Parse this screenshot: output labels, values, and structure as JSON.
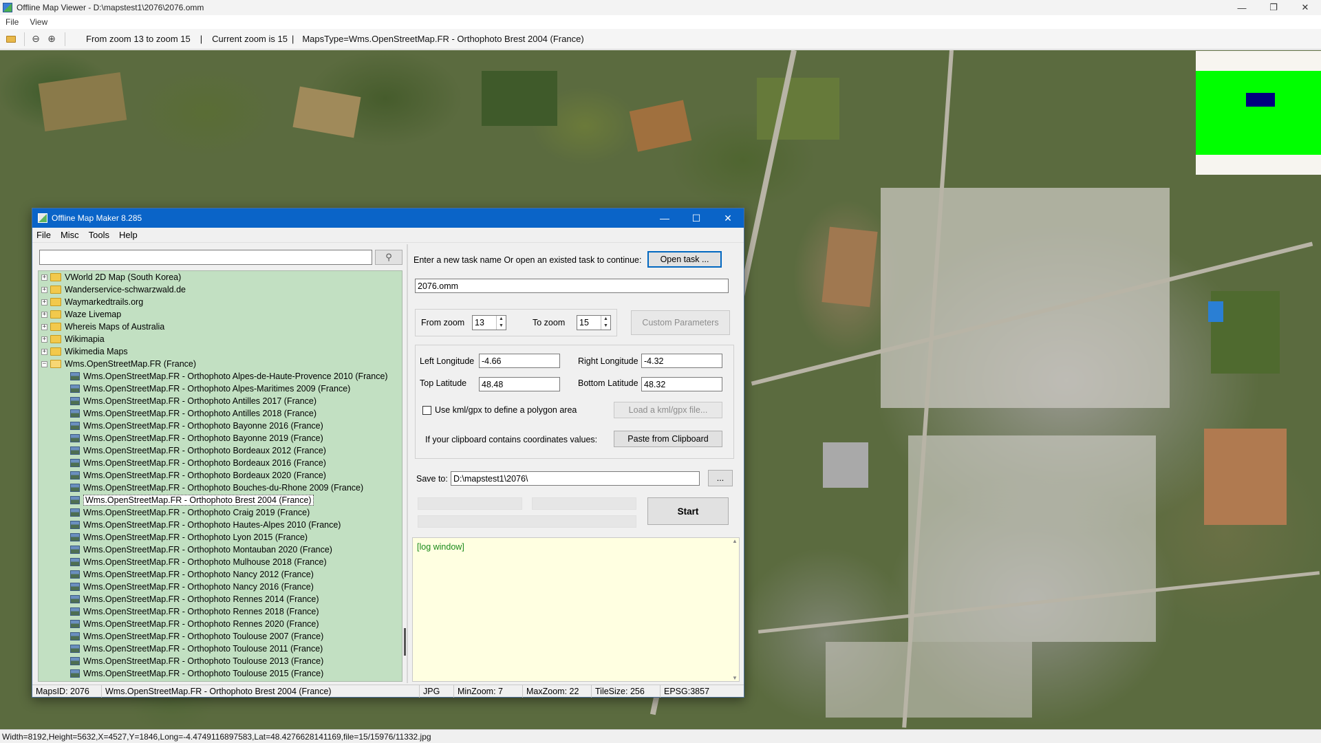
{
  "viewer": {
    "title": "Offline Map Viewer - D:\\mapstest1\\2076\\2076.omm",
    "menu": [
      "File",
      "View"
    ],
    "toolbar": {
      "zoom_range": "From zoom 13 to zoom 15",
      "current_zoom": "Current zoom is 15",
      "maps_type": "MapsType=Wms.OpenStreetMap.FR - Orthophoto Brest 2004 (France)",
      "separator": "|"
    },
    "status": "Width=8192,Height=5632,X=4527,Y=1846,Long=-4.4749116897583,Lat=48.4276628141169,file=15/15976/11332.jpg"
  },
  "dialog": {
    "title": "Offline Map Maker 8.285",
    "menu": [
      "File",
      "Misc",
      "Tools",
      "Help"
    ],
    "search": {
      "value": "",
      "placeholder": ""
    },
    "tree": {
      "folders": [
        "VWorld 2D Map (South Korea)",
        "Wanderservice-schwarzwald.de",
        "Waymarkedtrails.org",
        "Waze Livemap",
        "Whereis Maps of Australia",
        "Wikimapia",
        "Wikimedia Maps"
      ],
      "open_folder": "Wms.OpenStreetMap.FR (France)",
      "children": [
        "Wms.OpenStreetMap.FR - Orthophoto Alpes-de-Haute-Provence 2010 (France)",
        "Wms.OpenStreetMap.FR - Orthophoto Alpes-Maritimes 2009 (France)",
        "Wms.OpenStreetMap.FR - Orthophoto Antilles 2017 (France)",
        "Wms.OpenStreetMap.FR - Orthophoto Antilles 2018 (France)",
        "Wms.OpenStreetMap.FR - Orthophoto Bayonne 2016 (France)",
        "Wms.OpenStreetMap.FR - Orthophoto Bayonne 2019 (France)",
        "Wms.OpenStreetMap.FR - Orthophoto Bordeaux 2012 (France)",
        "Wms.OpenStreetMap.FR - Orthophoto Bordeaux 2016 (France)",
        "Wms.OpenStreetMap.FR - Orthophoto Bordeaux 2020 (France)",
        "Wms.OpenStreetMap.FR - Orthophoto Bouches-du-Rhone 2009 (France)",
        "Wms.OpenStreetMap.FR - Orthophoto Brest 2004 (France)",
        "Wms.OpenStreetMap.FR - Orthophoto Craig 2019 (France)",
        "Wms.OpenStreetMap.FR - Orthophoto Hautes-Alpes 2010 (France)",
        "Wms.OpenStreetMap.FR - Orthophoto Lyon 2015 (France)",
        "Wms.OpenStreetMap.FR - Orthophoto Montauban 2020 (France)",
        "Wms.OpenStreetMap.FR - Orthophoto Mulhouse 2018 (France)",
        "Wms.OpenStreetMap.FR - Orthophoto Nancy 2012 (France)",
        "Wms.OpenStreetMap.FR - Orthophoto Nancy 2016 (France)",
        "Wms.OpenStreetMap.FR - Orthophoto Rennes 2014 (France)",
        "Wms.OpenStreetMap.FR - Orthophoto Rennes 2018 (France)",
        "Wms.OpenStreetMap.FR - Orthophoto Rennes 2020 (France)",
        "Wms.OpenStreetMap.FR - Orthophoto Toulouse 2007 (France)",
        "Wms.OpenStreetMap.FR - Orthophoto Toulouse 2011 (France)",
        "Wms.OpenStreetMap.FR - Orthophoto Toulouse 2013 (France)",
        "Wms.OpenStreetMap.FR - Orthophoto Toulouse 2015 (France)"
      ],
      "selected": "Wms.OpenStreetMap.FR - Orthophoto Brest 2004 (France)"
    },
    "task": {
      "prompt": "Enter a new task name Or open an existed task to continue:",
      "open_button": "Open task ...",
      "name_value": "2076.omm"
    },
    "zoom": {
      "from_label": "From zoom",
      "from_value": "13",
      "to_label": "To zoom",
      "to_value": "15",
      "custom_button": "Custom Parameters"
    },
    "bounds": {
      "left_label": "Left Longitude",
      "left_value": "-4.66",
      "right_label": "Right Longitude",
      "right_value": "-4.32",
      "top_label": "Top Latitude",
      "top_value": "48.48",
      "bottom_label": "Bottom Latitude",
      "bottom_value": "48.32",
      "kml_label": "Use kml/gpx to define a polygon area",
      "kml_button": "Load a kml/gpx file...",
      "clipboard_label": "If your clipboard contains coordinates values:",
      "clipboard_button": "Paste from Clipboard"
    },
    "save": {
      "label": "Save to:",
      "value": "D:\\mapstest1\\2076\\",
      "browse_button": "...",
      "start_button": "Start"
    },
    "log": "[log window]",
    "status": {
      "maps_id": "MapsID: 2076",
      "maps_name": "Wms.OpenStreetMap.FR - Orthophoto Brest 2004 (France)",
      "format": "JPG",
      "min_zoom": "MinZoom: 7",
      "max_zoom": "MaxZoom: 22",
      "tile_size": "TileSize: 256",
      "epsg": "EPSG:3857"
    }
  },
  "colors": {
    "dialog_title_bg": "#0a64c8",
    "tree_bg": "#c2e0c2",
    "log_bg": "#ffffe1",
    "log_text": "#1a8a1a",
    "overview_green": "#00ff00",
    "overview_view": "#000080"
  }
}
